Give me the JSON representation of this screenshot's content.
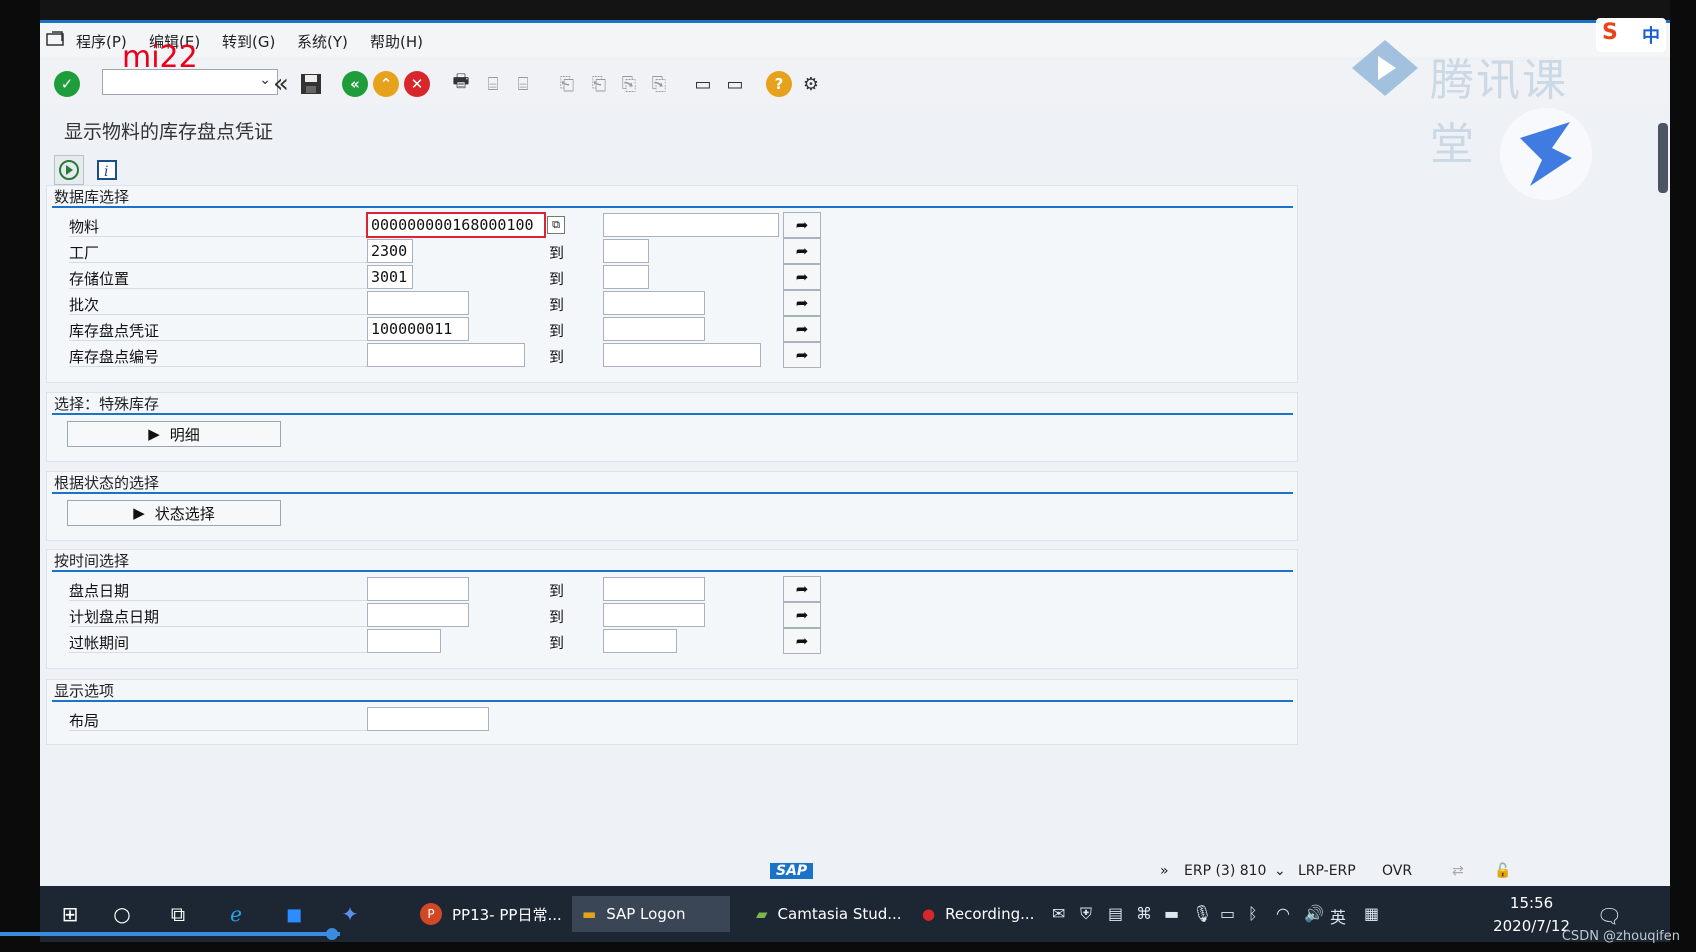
{
  "window": {
    "title_fragment": ""
  },
  "menu": [
    "程序(P)",
    "编辑(E)",
    "转到(G)",
    "系统(Y)",
    "帮助(H)"
  ],
  "command_field": {
    "value": "",
    "overlay_text": "mi22"
  },
  "page_title": "显示物料的库存盘点凭证",
  "watermark": {
    "text": "腾讯课堂"
  },
  "ime": {
    "mode": "中"
  },
  "groups": {
    "db": {
      "title": "数据库选择",
      "rows": [
        {
          "label": "物料",
          "from": "000000000168000100",
          "to_label": "",
          "to": ""
        },
        {
          "label": "工厂",
          "from": "2300",
          "to_label": "到",
          "to": ""
        },
        {
          "label": "存储位置",
          "from": "3001",
          "to_label": "到",
          "to": ""
        },
        {
          "label": "批次",
          "from": "",
          "to_label": "到",
          "to": ""
        },
        {
          "label": "库存盘点凭证",
          "from": "100000011",
          "to_label": "到",
          "to": ""
        },
        {
          "label": "库存盘点编号",
          "from": "",
          "to_label": "到",
          "to": ""
        }
      ]
    },
    "special": {
      "title": "选择：特殊库存",
      "button": "明细"
    },
    "status": {
      "title": "根据状态的选择",
      "button": "状态选择"
    },
    "time": {
      "title": "按时间选择",
      "rows": [
        {
          "label": "盘点日期",
          "from": "",
          "to_label": "到",
          "to": ""
        },
        {
          "label": "计划盘点日期",
          "from": "",
          "to_label": "到",
          "to": ""
        },
        {
          "label": "过帐期间",
          "from": "",
          "to_label": "到",
          "to": ""
        }
      ]
    },
    "display": {
      "title": "显示选项",
      "rows": [
        {
          "label": "布局",
          "value": ""
        }
      ]
    }
  },
  "statusbar": {
    "system": "ERP (3) 810",
    "server": "LRP-ERP",
    "mode": "OVR",
    "logo": "SAP"
  },
  "taskbar": {
    "apps": [
      "PP13- PP日常...",
      "SAP Logon",
      "Camtasia Stud...",
      "Recording..."
    ],
    "lang": "英",
    "time": "15:56",
    "date": "2020/7/12"
  },
  "credit": "CSDN @zhouqifen",
  "colors": {
    "accent": "#1a73c8",
    "ok_green": "#1f9d3a",
    "cancel_red": "#d9262c",
    "nav_yellow": "#e6a21c"
  }
}
